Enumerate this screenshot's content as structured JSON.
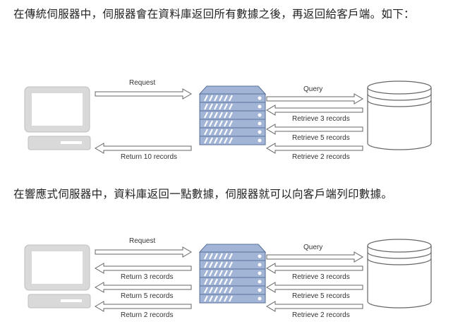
{
  "text": {
    "para1": "在傳統伺服器中，伺服器會在資料庫返回所有數據之後，再返回給客戶端。如下：",
    "para2": "在響應式伺服器中，資料庫返回一點數據，伺服器就可以向客戶端列印數據。"
  },
  "diagram1": {
    "request_label": "Request",
    "query_label": "Query",
    "db_returns": [
      "Retrieve 3 records",
      "Retrieve 5 records",
      "Retrieve 2 records"
    ],
    "client_returns": [
      "Return 10 records"
    ]
  },
  "diagram2": {
    "request_label": "Request",
    "query_label": "Query",
    "db_returns": [
      "Retrieve 3 records",
      "Retrieve 5 records",
      "Retrieve 2 records"
    ],
    "client_returns": [
      "Return 3 records",
      "Return 5 records",
      "Return 2 records"
    ]
  },
  "colors": {
    "server_fill": "#a3b5d6",
    "server_stroke": "#5a6f99",
    "computer_fill": "#d9d9d9",
    "line": "#666666"
  }
}
